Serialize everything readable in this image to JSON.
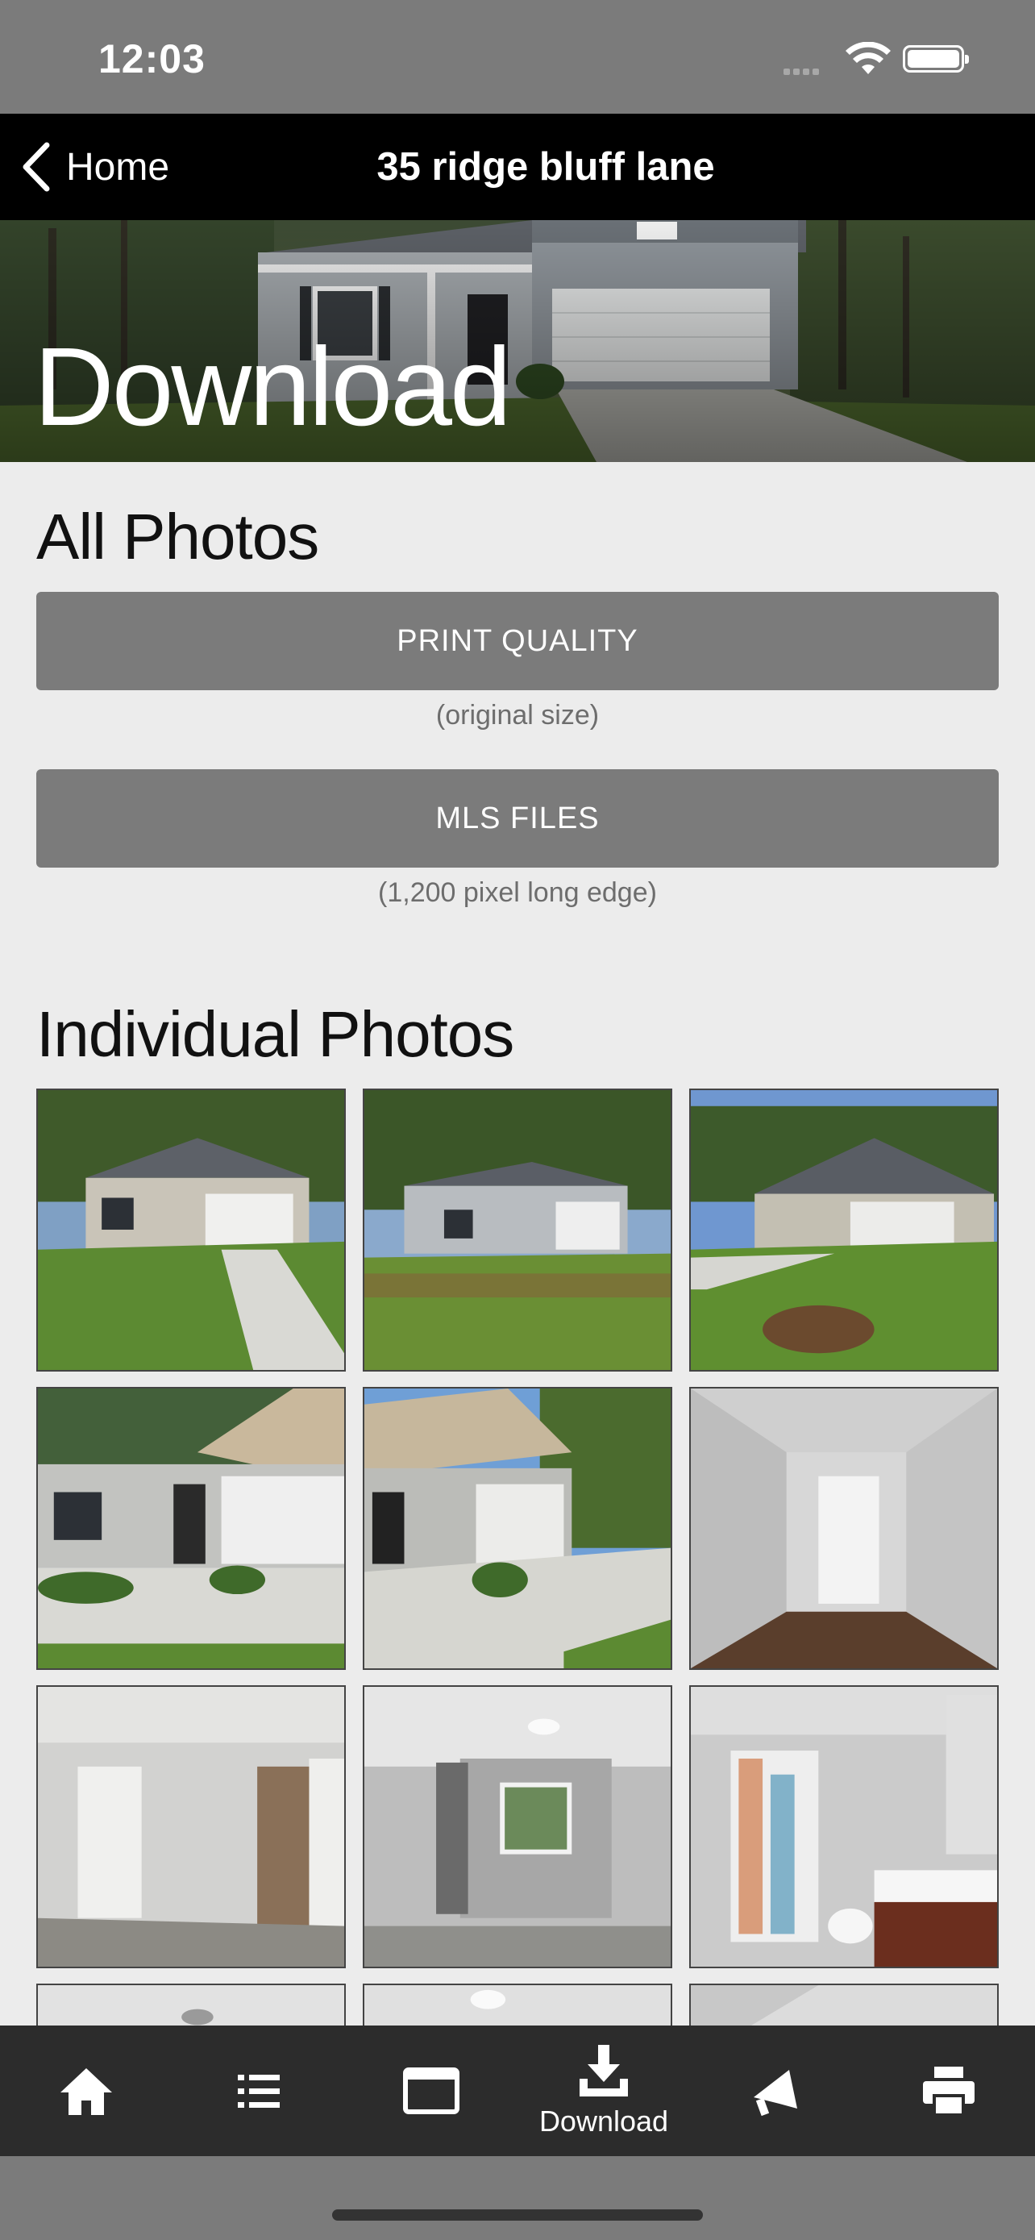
{
  "status_bar": {
    "time": "12:03"
  },
  "nav": {
    "back_label": "Home",
    "title": "35 ridge bluff lane"
  },
  "hero": {
    "title": "Download"
  },
  "all_photos": {
    "heading": "All Photos",
    "print_quality": {
      "label": "PRINT QUALITY",
      "caption": "(original size)"
    },
    "mls_files": {
      "label": "MLS FILES",
      "caption": "(1,200 pixel long edge)"
    }
  },
  "individual_photos": {
    "heading": "Individual Photos",
    "thumbnails": [
      "exterior-front-1",
      "exterior-front-2",
      "exterior-side",
      "porch-entry",
      "garage-angle",
      "hallway-door",
      "bedroom-doors",
      "bedroom-window",
      "bathroom",
      "interior-ceiling-1",
      "interior-ceiling-2",
      "interior-ceiling-3"
    ]
  },
  "tab_bar": {
    "items": [
      {
        "icon": "home-icon",
        "label": ""
      },
      {
        "icon": "list-icon",
        "label": ""
      },
      {
        "icon": "browser-window-icon",
        "label": ""
      },
      {
        "icon": "download-icon",
        "label": "Download"
      },
      {
        "icon": "megaphone-icon",
        "label": ""
      },
      {
        "icon": "printer-icon",
        "label": ""
      }
    ]
  },
  "colors": {
    "status_bar": "#7b7b7b",
    "nav_bar": "#000000",
    "button": "#7b7b7b",
    "page_bg": "#ececec",
    "tab_bar": "#2c2c2c"
  }
}
